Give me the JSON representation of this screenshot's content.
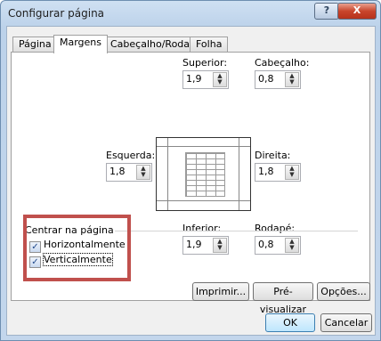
{
  "window": {
    "title": "Configurar página"
  },
  "titlebar": {
    "help_label": "?",
    "close_label": "X"
  },
  "tabs": [
    {
      "label": "Página",
      "active": false
    },
    {
      "label": "Margens",
      "active": true
    },
    {
      "label": "Cabeçalho/Rodapé",
      "active": false
    },
    {
      "label": "Folha",
      "active": false
    }
  ],
  "margins": {
    "superior": {
      "label": "Superior:",
      "value": "1,9"
    },
    "cabecalho": {
      "label": "Cabeçalho:",
      "value": "0,8"
    },
    "esquerda": {
      "label": "Esquerda:",
      "value": "1,8"
    },
    "direita": {
      "label": "Direita:",
      "value": "1,8"
    },
    "inferior": {
      "label": "Inferior:",
      "value": "1,9"
    },
    "rodape": {
      "label": "Rodapé:",
      "value": "0,8"
    }
  },
  "center": {
    "legend": "Centrar na página",
    "horizontal": {
      "label": "Horizontalmente",
      "checked": true
    },
    "vertical": {
      "label": "Verticalmente",
      "checked": true
    }
  },
  "buttons": {
    "print": "Imprimir...",
    "preview": "Pré-visualizar",
    "options": "Opções...",
    "ok": "OK",
    "cancel": "Cancelar"
  },
  "colors": {
    "highlight": "#c0504d",
    "title_bar": "#bcd2ea"
  }
}
